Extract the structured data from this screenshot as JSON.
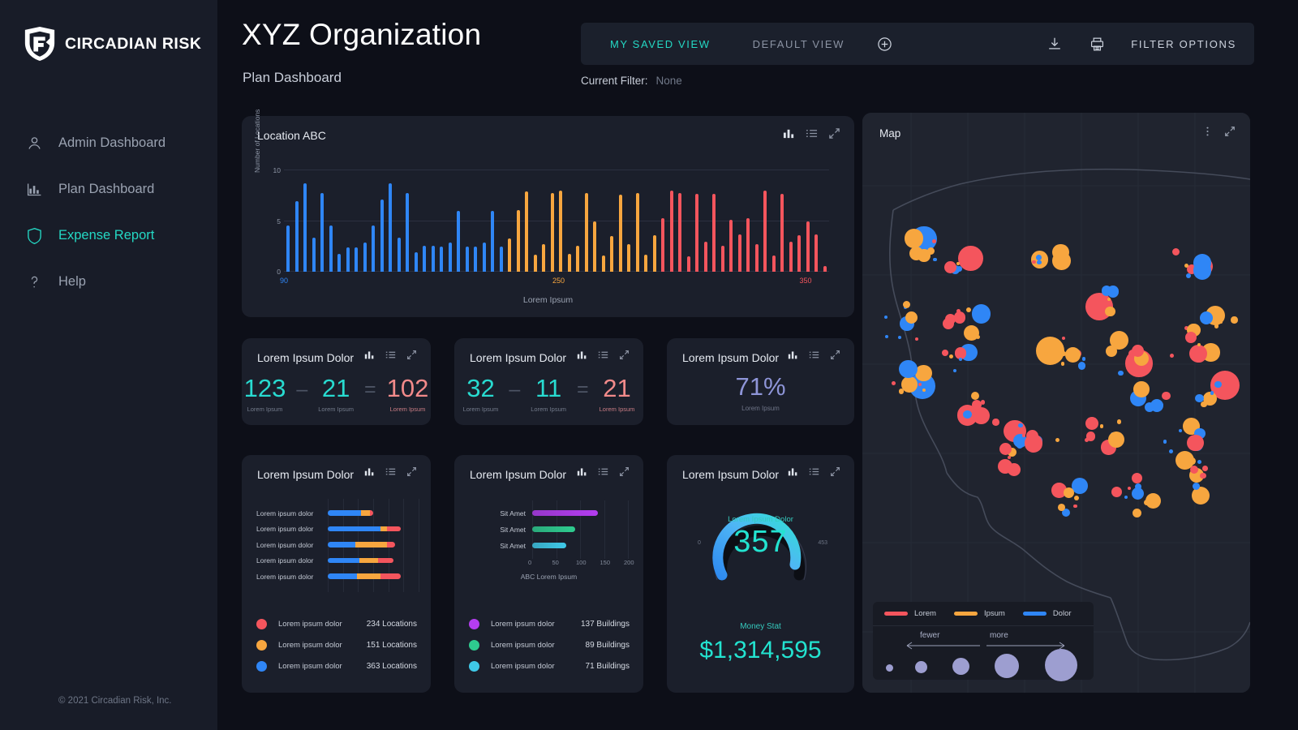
{
  "brand": {
    "name": "CIRCADIAN RISK",
    "logo_icon": "shield-logo-icon"
  },
  "sidebar": {
    "items": [
      {
        "label": "Admin Dashboard",
        "icon": "user-icon",
        "active": false
      },
      {
        "label": "Plan Dashboard",
        "icon": "bar-chart-icon",
        "active": false
      },
      {
        "label": "Expense Report",
        "icon": "shield-icon",
        "active": true
      },
      {
        "label": "Help",
        "icon": "question-mark-icon",
        "active": false
      }
    ],
    "copyright": "© 2021 Circadian Risk, Inc."
  },
  "header": {
    "title": "XYZ Organization",
    "subtitle": "Plan Dashboard",
    "tabs": [
      {
        "label": "MY SAVED VIEW",
        "active": true
      },
      {
        "label": "DEFAULT VIEW",
        "active": false
      }
    ],
    "add_view_icon": "plus-circle-icon",
    "download_icon": "download-icon",
    "print_icon": "printer-icon",
    "filter_options_label": "FILTER OPTIONS",
    "current_filter_label": "Current Filter:",
    "current_filter_value": "None"
  },
  "colors": {
    "accent_teal": "#24d8c4",
    "blue": "#2f86f6",
    "orange": "#f7a63f",
    "red": "#f4555d",
    "purple": "#8e95d8",
    "magenta": "#b43df0",
    "green": "#2ecc8f",
    "cyan": "#3fc9e8"
  },
  "card_icons": {
    "chart": "bar-chart-icon",
    "list": "list-icon",
    "expand": "expand-arrows-icon"
  },
  "location_card": {
    "title": "Location ABC",
    "chart_data": {
      "type": "bar",
      "title": "Location ABC",
      "xlabel": "Lorem Ipsum",
      "ylabel": "Number of Locations",
      "ylim": [
        0,
        10
      ],
      "yticks": [
        0,
        5,
        10
      ],
      "grid": true,
      "legend": "none",
      "xticks": [
        {
          "label": "90",
          "color": "#2f86f6",
          "index": 0
        },
        {
          "label": "250",
          "color": "#f7a63f",
          "index": 32
        },
        {
          "label": "350",
          "color": "#f4555d",
          "index": 61
        }
      ],
      "values": [
        4.6,
        7.0,
        8.7,
        3.4,
        7.8,
        4.6,
        1.8,
        2.4,
        2.4,
        2.9,
        4.6,
        7.1,
        8.7,
        3.4,
        7.8,
        1.9,
        2.6,
        2.6,
        2.5,
        2.9,
        6.0,
        2.5,
        2.5,
        2.9,
        6.0,
        2.5,
        3.3,
        6.1,
        7.9,
        1.7,
        2.7,
        7.8,
        8.0,
        1.8,
        2.6,
        7.8,
        5.0,
        1.6,
        3.5,
        7.6,
        2.7,
        7.8,
        1.7,
        3.6,
        5.3,
        8.0,
        7.8,
        1.5,
        7.7,
        3.0,
        7.7,
        2.6,
        5.1,
        3.7,
        5.3,
        2.7,
        8.0,
        1.6,
        7.7,
        3.0,
        3.6,
        5.0,
        3.7,
        0.6
      ],
      "colors": [
        "blue",
        "orange",
        "red"
      ],
      "color_breaks": [
        26,
        44
      ]
    }
  },
  "kpi_cards": [
    {
      "title": "Lorem Ipsum Dolor",
      "type": "equation",
      "terms": [
        {
          "value": "123",
          "sub": "Lorem Ipsum",
          "style": "teal"
        },
        {
          "op": "–"
        },
        {
          "value": "21",
          "sub": "Lorem Ipsum",
          "style": "teal"
        },
        {
          "op": "="
        },
        {
          "value": "102",
          "sub": "Lorem Ipsum",
          "style": "pink"
        }
      ]
    },
    {
      "title": "Lorem Ipsum Dolor",
      "type": "equation",
      "terms": [
        {
          "value": "32",
          "sub": "Lorem Ipsum",
          "style": "teal"
        },
        {
          "op": "–"
        },
        {
          "value": "11",
          "sub": "Lorem Ipsum",
          "style": "teal"
        },
        {
          "op": "="
        },
        {
          "value": "21",
          "sub": "Lorem Ipsum",
          "style": "pink"
        }
      ]
    },
    {
      "title": "Lorem Ipsum Dolor",
      "type": "percent",
      "value": "71%",
      "sub": "Lorem Ipsum"
    }
  ],
  "locations_card": {
    "title": "Lorem Ipsum Dolor",
    "chart_data": {
      "type": "bar",
      "orientation": "horizontal",
      "stacked": true,
      "categories": [
        "Lorem ipsum dolor",
        "Lorem ipsum dolor",
        "Lorem ipsum dolor",
        "Lorem ipsum dolor",
        "Lorem ipsum dolor"
      ],
      "series": [
        {
          "name": "Lorem ipsum dolor",
          "color": "#2f86f6",
          "values": [
            46,
            72,
            38,
            44,
            40
          ]
        },
        {
          "name": "Lorem ipsum dolor",
          "color": "#f7a63f",
          "values": [
            12,
            10,
            43,
            25,
            33
          ]
        },
        {
          "name": "Lorem ipsum dolor",
          "color": "#f4555d",
          "values": [
            4,
            18,
            12,
            21,
            27
          ]
        }
      ],
      "grid": true
    },
    "legend": [
      {
        "label": "Lorem ipsum dolor",
        "value": "234 Locations",
        "color": "#f4555d"
      },
      {
        "label": "Lorem ipsum dolor",
        "value": "151 Locations",
        "color": "#f7a63f"
      },
      {
        "label": "Lorem ipsum dolor",
        "value": "363 Locations",
        "color": "#2f86f6"
      }
    ]
  },
  "buildings_card": {
    "title": "Lorem Ipsum Dolor",
    "chart_data": {
      "type": "bar",
      "orientation": "horizontal",
      "categories": [
        "Sit Amet",
        "Sit Amet",
        "Sit Amet"
      ],
      "values": [
        137,
        89,
        71
      ],
      "xlabel": "ABC Lorem Ipsum",
      "xticks": [
        "0",
        "50",
        "100",
        "150",
        "200"
      ],
      "xlim": [
        0,
        200
      ],
      "bar_colors": [
        "#b43df0",
        "#2ecc8f",
        "#3fc9e8"
      ],
      "grid": true
    },
    "legend": [
      {
        "label": "Lorem ipsum dolor",
        "value": "137 Buildings",
        "color": "#b43df0"
      },
      {
        "label": "Lorem ipsum dolor",
        "value": "89 Buildings",
        "color": "#2ecc8f"
      },
      {
        "label": "Lorem ipsum dolor",
        "value": "71 Buildings",
        "color": "#3fc9e8"
      }
    ]
  },
  "gauge_card": {
    "title": "Lorem Ipsum Dolor",
    "chart_data": {
      "type": "gauge",
      "label": "Lorem Ipsum Dolor",
      "value": 357,
      "min": 0,
      "max": 453,
      "value_text": "357",
      "min_text": "0",
      "max_text": "453"
    },
    "money_label": "Money Stat",
    "money_value": "$1,314,595"
  },
  "map_card": {
    "title": "Map",
    "menu_icon": "kebab-menu-icon",
    "expand_icon": "expand-arrows-icon",
    "legend": {
      "series": [
        {
          "label": "Lorem",
          "color": "#f4555d"
        },
        {
          "label": "Ipsum",
          "color": "#f7a63f"
        },
        {
          "label": "Dolor",
          "color": "#2f86f6"
        }
      ],
      "scale_low_label": "fewer",
      "scale_high_label": "more"
    }
  }
}
